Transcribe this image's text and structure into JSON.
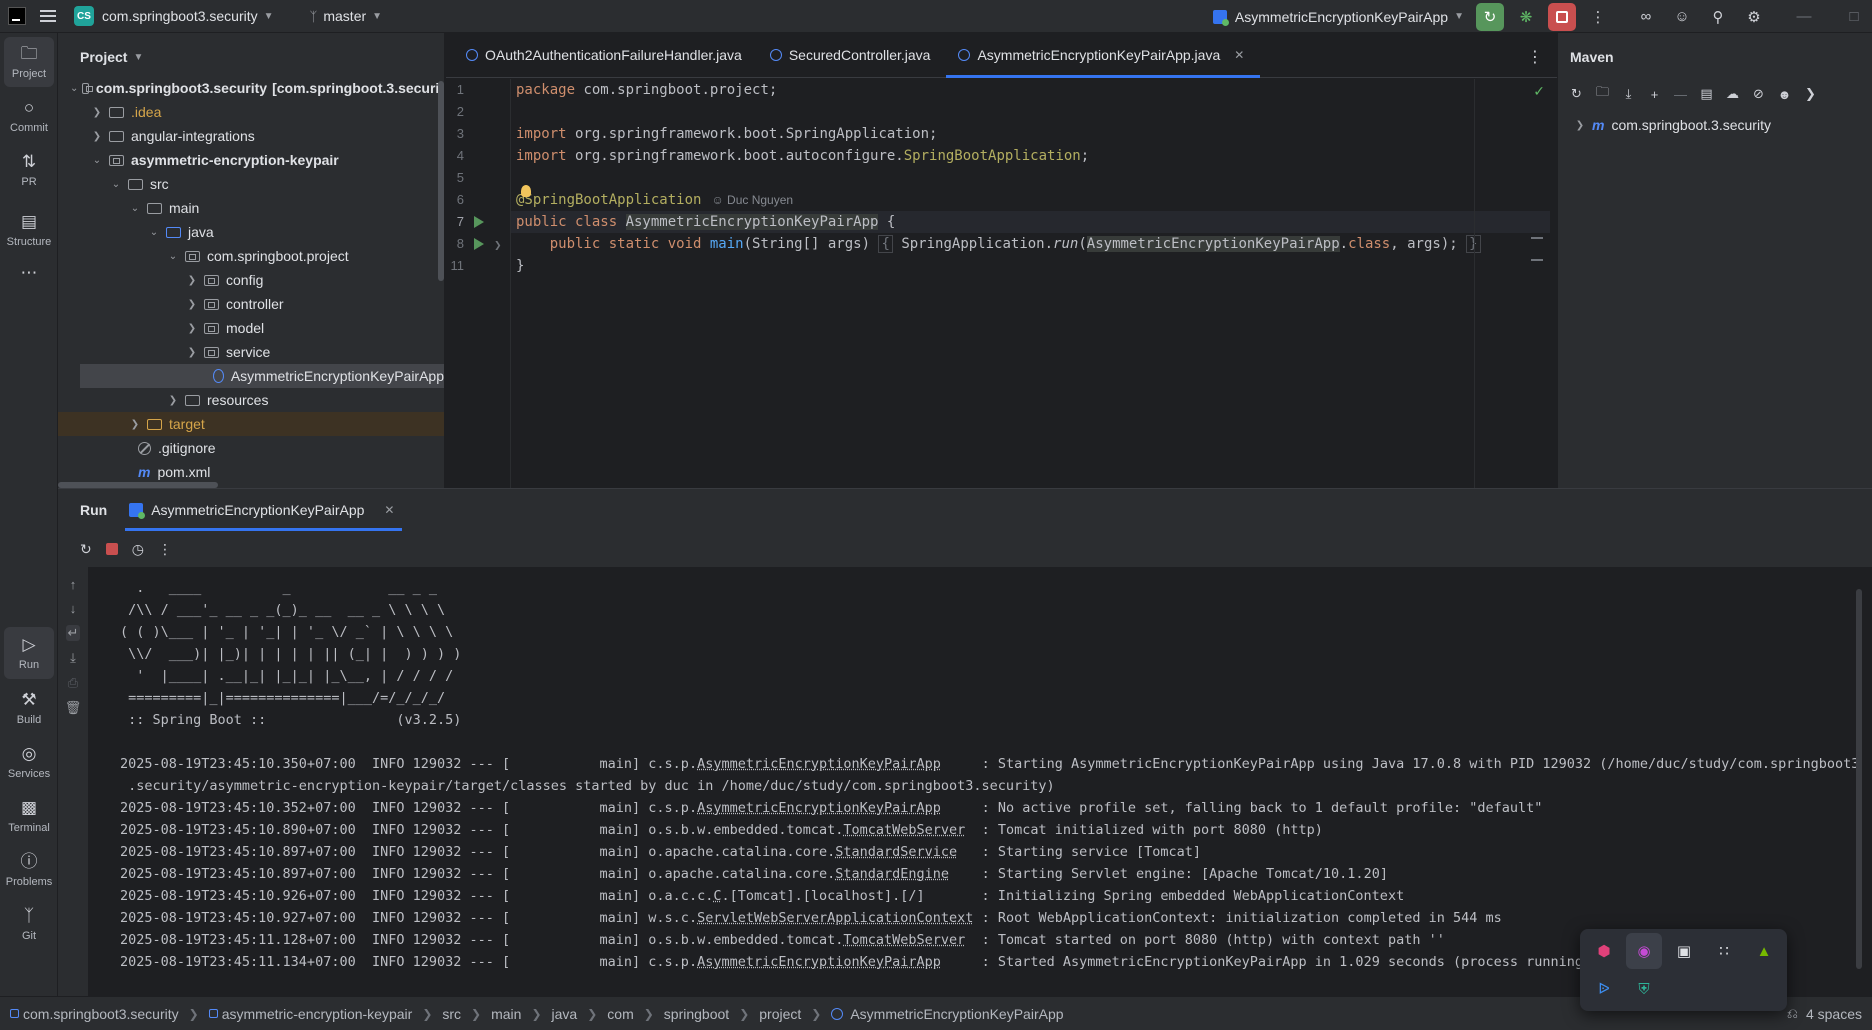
{
  "titlebar": {
    "project_badge": "CS",
    "project_name": "com.springboot3.security",
    "branch": "master",
    "run_config": "AsymmetricEncryptionKeyPairApp"
  },
  "left_stripe": {
    "items": [
      {
        "label": "Project",
        "icon": "folder-icon"
      },
      {
        "label": "Commit",
        "icon": "commit-icon"
      },
      {
        "label": "PR",
        "icon": "pull-request-icon"
      },
      {
        "label": "Structure",
        "icon": "structure-icon"
      },
      {
        "label": "Run",
        "icon": "run-icon"
      },
      {
        "label": "Build",
        "icon": "hammer-icon"
      },
      {
        "label": "Services",
        "icon": "services-icon"
      },
      {
        "label": "Terminal",
        "icon": "terminal-icon"
      },
      {
        "label": "Problems",
        "icon": "problems-icon"
      },
      {
        "label": "Git",
        "icon": "git-icon"
      }
    ]
  },
  "project": {
    "title": "Project",
    "root_name": "com.springboot3.security",
    "root_module": "[com.springboot.3.securit",
    "nodes": [
      ".idea",
      "angular-integrations",
      "asymmetric-encryption-keypair",
      "src",
      "main",
      "java",
      "com.springboot.project",
      "config",
      "controller",
      "model",
      "service",
      "AsymmetricEncryptionKeyPairApp",
      "resources",
      "target",
      ".gitignore",
      "pom.xml"
    ]
  },
  "editor": {
    "tabs": [
      "OAuth2AuthenticationFailureHandler.java",
      "SecuredController.java",
      "AsymmetricEncryptionKeyPairApp.java"
    ],
    "line_numbers": [
      "1",
      "2",
      "3",
      "4",
      "5",
      "6",
      "7",
      "8",
      "11"
    ],
    "code": {
      "l1_kw": "package",
      "l1_rest": " com.springboot.project;",
      "l3_kw": "import",
      "l3_rest": " org.springframework.boot.SpringApplication;",
      "l4_kw": "import",
      "l4_rest": " org.springframework.boot.autoconfigure.",
      "l4_ann": "SpringBootApplication",
      "l4_end": ";",
      "l6_ann": "@SpringBootApplication",
      "l6_author": "Duc Nguyen",
      "l7_kw": "public class ",
      "l7_cls": "AsymmetricEncryptionKeyPairApp",
      "l7_end": " {",
      "l8_indent": "    ",
      "l8_kw": "public static void ",
      "l8_fn": "main",
      "l8_params": "(String[] args) ",
      "l8_open": "{",
      "l8_body1": " SpringApplication.",
      "l8_run": "run",
      "l8_body2": "(",
      "l8_cls": "AsymmetricEncryptionKeyPairApp",
      "l8_dot": ".",
      "l8_class_kw": "class",
      "l8_body3": ", args); ",
      "l8_close": "}",
      "l11": "}"
    }
  },
  "maven": {
    "title": "Maven",
    "project": "com.springboot.3.security"
  },
  "run": {
    "title": "Run",
    "tab_label": "AsymmetricEncryptionKeyPairApp",
    "banner": [
      "  .   ____          _            __ _ _",
      " /\\\\ / ___'_ __ _ _(_)_ __  __ _ \\ \\ \\ \\",
      "( ( )\\___ | '_ | '_| | '_ \\/ _` | \\ \\ \\ \\",
      " \\\\/  ___)| |_)| | | | | || (_| |  ) ) ) )",
      "  '  |____| .__|_| |_|_| |_\\__, | / / / /",
      " =========|_|==============|___/=/_/_/_/",
      "",
      " :: Spring Boot ::                (v3.2.5)",
      ""
    ],
    "logs": [
      {
        "prefix": "2025-08-19T23:45:10.350+07:00  INFO 129032 --- [           main] c.s.p.",
        "cls": "AsymmetricEncryptionKeyPairApp",
        "pad": "     ",
        "msg": ": Starting AsymmetricEncryptionKeyPairApp using Java 17.0.8 with PID 129032 (/home/duc/study/com.springboot3"
      },
      {
        "prefix": " .security/asymmetric-encryption-keypair/target/classes started by duc in /home/duc/study/com.springboot3.security)",
        "cls": "",
        "pad": "",
        "msg": ""
      },
      {
        "prefix": "2025-08-19T23:45:10.352+07:00  INFO 129032 --- [           main] c.s.p.",
        "cls": "AsymmetricEncryptionKeyPairApp",
        "pad": "     ",
        "msg": ": No active profile set, falling back to 1 default profile: \"default\""
      },
      {
        "prefix": "2025-08-19T23:45:10.890+07:00  INFO 129032 --- [           main] o.s.b.w.embedded.tomcat.",
        "cls": "TomcatWebServer",
        "pad": "  ",
        "msg": ": Tomcat initialized with port 8080 (http)"
      },
      {
        "prefix": "2025-08-19T23:45:10.897+07:00  INFO 129032 --- [           main] o.apache.catalina.core.",
        "cls": "StandardService",
        "pad": "   ",
        "msg": ": Starting service [Tomcat]"
      },
      {
        "prefix": "2025-08-19T23:45:10.897+07:00  INFO 129032 --- [           main] o.apache.catalina.core.",
        "cls": "StandardEngine",
        "pad": "    ",
        "msg": ": Starting Servlet engine: [Apache Tomcat/10.1.20]"
      },
      {
        "prefix": "2025-08-19T23:45:10.926+07:00  INFO 129032 --- [           main] o.a.c.c.",
        "cls": "C",
        "pad": "",
        "msg": ".[Tomcat].[localhost].[/]       : Initializing Spring embedded WebApplicationContext"
      },
      {
        "prefix": "2025-08-19T23:45:10.927+07:00  INFO 129032 --- [           main] w.s.c.",
        "cls": "ServletWebServerApplicationContext",
        "pad": " ",
        "msg": ": Root WebApplicationContext: initialization completed in 544 ms"
      },
      {
        "prefix": "2025-08-19T23:45:11.128+07:00  INFO 129032 --- [           main] o.s.b.w.embedded.tomcat.",
        "cls": "TomcatWebServer",
        "pad": "  ",
        "msg": ": Tomcat started on port 8080 (http) with context path ''"
      },
      {
        "prefix": "2025-08-19T23:45:11.134+07:00  INFO 129032 --- [           main] c.s.p.",
        "cls": "AsymmetricEncryptionKeyPairApp",
        "pad": "     ",
        "msg": ": Started AsymmetricEncryptionKeyPairApp in 1.029 seconds (process running fo"
      }
    ]
  },
  "statusbar": {
    "crumbs": [
      "com.springboot3.security",
      "asymmetric-encryption-keypair",
      "src",
      "main",
      "java",
      "com",
      "springboot",
      "project",
      "AsymmetricEncryptionKeyPairApp"
    ],
    "indent": "4 spaces"
  },
  "colors": {
    "accent": "#3574f0",
    "run_green": "#57965c",
    "stop_red": "#c94f4f",
    "keyword": "#cf8e6d",
    "annotation": "#b3ae60",
    "function": "#56a8f5"
  }
}
